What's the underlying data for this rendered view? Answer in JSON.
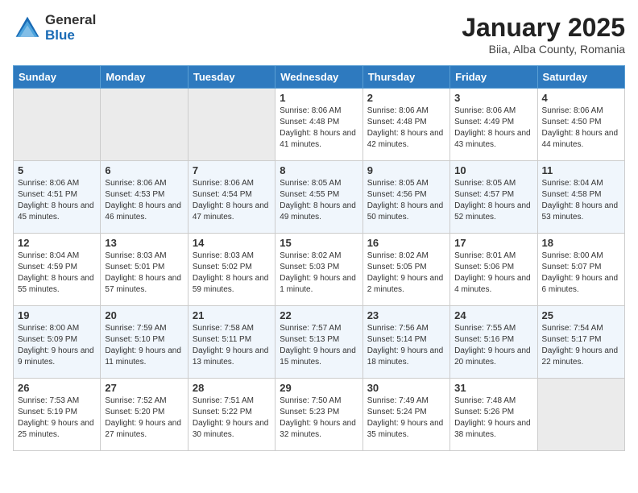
{
  "header": {
    "logo_general": "General",
    "logo_blue": "Blue",
    "title": "January 2025",
    "subtitle": "Biia, Alba County, Romania"
  },
  "days_of_week": [
    "Sunday",
    "Monday",
    "Tuesday",
    "Wednesday",
    "Thursday",
    "Friday",
    "Saturday"
  ],
  "weeks": [
    [
      {
        "num": "",
        "info": ""
      },
      {
        "num": "",
        "info": ""
      },
      {
        "num": "",
        "info": ""
      },
      {
        "num": "1",
        "info": "Sunrise: 8:06 AM\nSunset: 4:48 PM\nDaylight: 8 hours and 41 minutes."
      },
      {
        "num": "2",
        "info": "Sunrise: 8:06 AM\nSunset: 4:48 PM\nDaylight: 8 hours and 42 minutes."
      },
      {
        "num": "3",
        "info": "Sunrise: 8:06 AM\nSunset: 4:49 PM\nDaylight: 8 hours and 43 minutes."
      },
      {
        "num": "4",
        "info": "Sunrise: 8:06 AM\nSunset: 4:50 PM\nDaylight: 8 hours and 44 minutes."
      }
    ],
    [
      {
        "num": "5",
        "info": "Sunrise: 8:06 AM\nSunset: 4:51 PM\nDaylight: 8 hours and 45 minutes."
      },
      {
        "num": "6",
        "info": "Sunrise: 8:06 AM\nSunset: 4:53 PM\nDaylight: 8 hours and 46 minutes."
      },
      {
        "num": "7",
        "info": "Sunrise: 8:06 AM\nSunset: 4:54 PM\nDaylight: 8 hours and 47 minutes."
      },
      {
        "num": "8",
        "info": "Sunrise: 8:05 AM\nSunset: 4:55 PM\nDaylight: 8 hours and 49 minutes."
      },
      {
        "num": "9",
        "info": "Sunrise: 8:05 AM\nSunset: 4:56 PM\nDaylight: 8 hours and 50 minutes."
      },
      {
        "num": "10",
        "info": "Sunrise: 8:05 AM\nSunset: 4:57 PM\nDaylight: 8 hours and 52 minutes."
      },
      {
        "num": "11",
        "info": "Sunrise: 8:04 AM\nSunset: 4:58 PM\nDaylight: 8 hours and 53 minutes."
      }
    ],
    [
      {
        "num": "12",
        "info": "Sunrise: 8:04 AM\nSunset: 4:59 PM\nDaylight: 8 hours and 55 minutes."
      },
      {
        "num": "13",
        "info": "Sunrise: 8:03 AM\nSunset: 5:01 PM\nDaylight: 8 hours and 57 minutes."
      },
      {
        "num": "14",
        "info": "Sunrise: 8:03 AM\nSunset: 5:02 PM\nDaylight: 8 hours and 59 minutes."
      },
      {
        "num": "15",
        "info": "Sunrise: 8:02 AM\nSunset: 5:03 PM\nDaylight: 9 hours and 1 minute."
      },
      {
        "num": "16",
        "info": "Sunrise: 8:02 AM\nSunset: 5:05 PM\nDaylight: 9 hours and 2 minutes."
      },
      {
        "num": "17",
        "info": "Sunrise: 8:01 AM\nSunset: 5:06 PM\nDaylight: 9 hours and 4 minutes."
      },
      {
        "num": "18",
        "info": "Sunrise: 8:00 AM\nSunset: 5:07 PM\nDaylight: 9 hours and 6 minutes."
      }
    ],
    [
      {
        "num": "19",
        "info": "Sunrise: 8:00 AM\nSunset: 5:09 PM\nDaylight: 9 hours and 9 minutes."
      },
      {
        "num": "20",
        "info": "Sunrise: 7:59 AM\nSunset: 5:10 PM\nDaylight: 9 hours and 11 minutes."
      },
      {
        "num": "21",
        "info": "Sunrise: 7:58 AM\nSunset: 5:11 PM\nDaylight: 9 hours and 13 minutes."
      },
      {
        "num": "22",
        "info": "Sunrise: 7:57 AM\nSunset: 5:13 PM\nDaylight: 9 hours and 15 minutes."
      },
      {
        "num": "23",
        "info": "Sunrise: 7:56 AM\nSunset: 5:14 PM\nDaylight: 9 hours and 18 minutes."
      },
      {
        "num": "24",
        "info": "Sunrise: 7:55 AM\nSunset: 5:16 PM\nDaylight: 9 hours and 20 minutes."
      },
      {
        "num": "25",
        "info": "Sunrise: 7:54 AM\nSunset: 5:17 PM\nDaylight: 9 hours and 22 minutes."
      }
    ],
    [
      {
        "num": "26",
        "info": "Sunrise: 7:53 AM\nSunset: 5:19 PM\nDaylight: 9 hours and 25 minutes."
      },
      {
        "num": "27",
        "info": "Sunrise: 7:52 AM\nSunset: 5:20 PM\nDaylight: 9 hours and 27 minutes."
      },
      {
        "num": "28",
        "info": "Sunrise: 7:51 AM\nSunset: 5:22 PM\nDaylight: 9 hours and 30 minutes."
      },
      {
        "num": "29",
        "info": "Sunrise: 7:50 AM\nSunset: 5:23 PM\nDaylight: 9 hours and 32 minutes."
      },
      {
        "num": "30",
        "info": "Sunrise: 7:49 AM\nSunset: 5:24 PM\nDaylight: 9 hours and 35 minutes."
      },
      {
        "num": "31",
        "info": "Sunrise: 7:48 AM\nSunset: 5:26 PM\nDaylight: 9 hours and 38 minutes."
      },
      {
        "num": "",
        "info": ""
      }
    ]
  ]
}
